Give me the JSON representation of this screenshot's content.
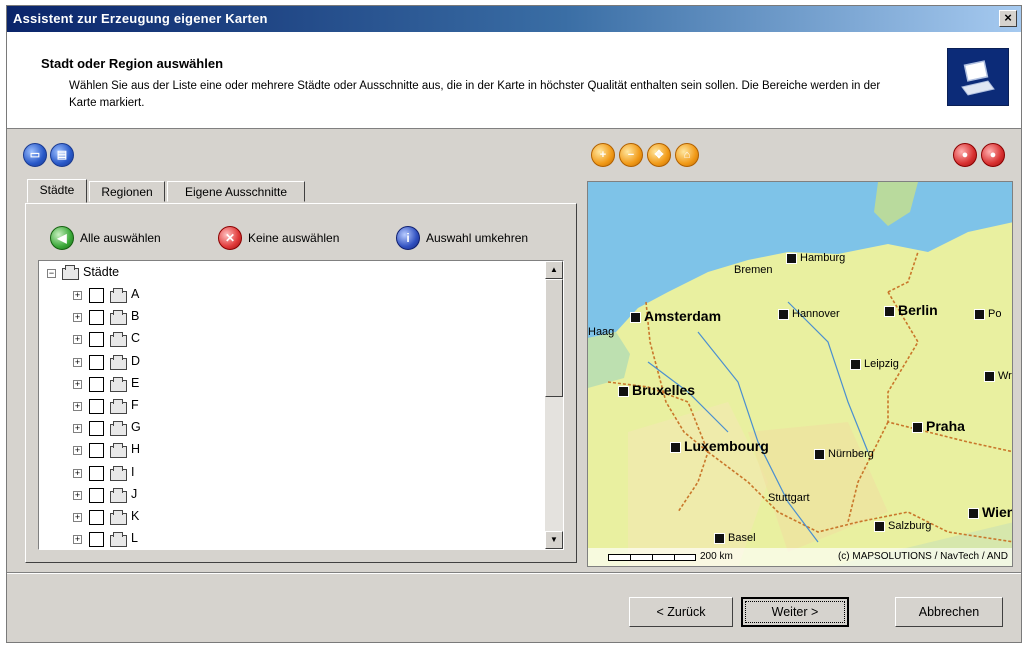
{
  "window": {
    "title": "Assistent zur Erzeugung eigener Karten",
    "close_label": "×"
  },
  "header": {
    "title": "Stadt oder Region auswählen",
    "description": "Wählen Sie aus der Liste eine oder mehrere Städte oder Ausschnitte aus, die in der Karte in höchster Qualität enthalten sein sollen. Die Bereiche werden in der Karte markiert."
  },
  "toolbar_left": {
    "icons": [
      "new-icon",
      "save-icon"
    ]
  },
  "toolbar_map": {
    "icons": [
      "zoom-in-icon",
      "zoom-out-icon",
      "pan-icon",
      "fit-icon"
    ]
  },
  "toolbar_right": {
    "icons": [
      "info-icon",
      "help-icon"
    ]
  },
  "tabs": [
    {
      "label": "Städte",
      "active": true
    },
    {
      "label": "Regionen",
      "active": false
    },
    {
      "label": "Eigene Ausschnitte",
      "active": false
    }
  ],
  "actions": [
    {
      "label": "Alle auswählen",
      "icon": "select-all-icon"
    },
    {
      "label": "Keine auswählen",
      "icon": "deselect-all-icon"
    },
    {
      "label": "Auswahl umkehren",
      "icon": "invert-selection-icon"
    }
  ],
  "tree": {
    "root": "Städte",
    "items": [
      "A",
      "B",
      "C",
      "D",
      "E",
      "F",
      "G",
      "H",
      "I",
      "J",
      "K",
      "L"
    ]
  },
  "map": {
    "cities": [
      {
        "name": "Hamburg",
        "size": "small"
      },
      {
        "name": "Bremen",
        "size": "small"
      },
      {
        "name": "Amsterdam",
        "size": "big"
      },
      {
        "name": "Hannover",
        "size": "small"
      },
      {
        "name": "Berlin",
        "size": "big"
      },
      {
        "name": "Po",
        "size": "small"
      },
      {
        "name": "Haag",
        "size": "small"
      },
      {
        "name": "Leipzig",
        "size": "small"
      },
      {
        "name": "Bruxelles",
        "size": "big"
      },
      {
        "name": "Wr",
        "size": "small"
      },
      {
        "name": "Praha",
        "size": "big"
      },
      {
        "name": "Luxembourg",
        "size": "big"
      },
      {
        "name": "Nürnberg",
        "size": "small"
      },
      {
        "name": "Stuttgart",
        "size": "small"
      },
      {
        "name": "Wien",
        "size": "big"
      },
      {
        "name": "Salzburg",
        "size": "small"
      },
      {
        "name": "Basel",
        "size": "small"
      }
    ],
    "scale_label": "200 km",
    "copyright": "(c) MAPSOLUTIONS / NavTech / AND",
    "colors": {
      "water": "#7ec3e8",
      "land": "#e9f0a0",
      "border": "#c9772b"
    }
  },
  "buttons": {
    "back": "< Zurück",
    "next": "Weiter >",
    "cancel": "Abbrechen"
  }
}
